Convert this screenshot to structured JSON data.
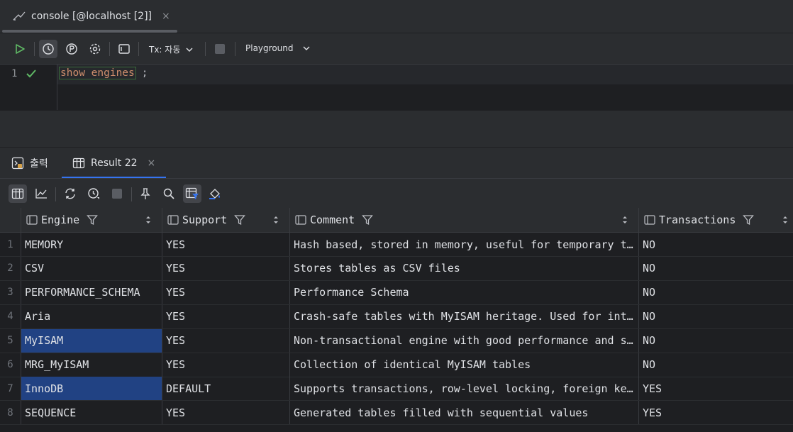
{
  "tab": {
    "title": "console [@localhost [2]]",
    "close": "×"
  },
  "toolbar": {
    "tx_label": "Tx: 자동",
    "playground_label": "Playground"
  },
  "editor": {
    "line_number": "1",
    "code_keyword": "show engines",
    "code_rest": ";"
  },
  "result_tabs": [
    {
      "label": "출력"
    },
    {
      "label": "Result 22",
      "close": "×"
    }
  ],
  "table": {
    "columns": [
      "Engine",
      "Support",
      "Comment",
      "Transactions"
    ],
    "rows": [
      {
        "num": "1",
        "engine": "MEMORY",
        "support": "YES",
        "comment": "Hash based, stored in memory, useful for temporary tables",
        "transactions": "NO"
      },
      {
        "num": "2",
        "engine": "CSV",
        "support": "YES",
        "comment": "Stores tables as CSV files",
        "transactions": "NO"
      },
      {
        "num": "3",
        "engine": "PERFORMANCE_SCHEMA",
        "support": "YES",
        "comment": "Performance Schema",
        "transactions": "NO"
      },
      {
        "num": "4",
        "engine": "Aria",
        "support": "YES",
        "comment": "Crash-safe tables with MyISAM heritage. Used for internal temporary tables",
        "transactions": "NO"
      },
      {
        "num": "5",
        "engine": "MyISAM",
        "support": "YES",
        "comment": "Non-transactional engine with good performance and small data footprint",
        "transactions": "NO"
      },
      {
        "num": "6",
        "engine": "MRG_MyISAM",
        "support": "YES",
        "comment": "Collection of identical MyISAM tables",
        "transactions": "NO"
      },
      {
        "num": "7",
        "engine": "InnoDB",
        "support": "DEFAULT",
        "comment": "Supports transactions, row-level locking, foreign keys and encryption for tables",
        "transactions": "YES"
      },
      {
        "num": "8",
        "engine": "SEQUENCE",
        "support": "YES",
        "comment": "Generated tables filled with sequential values",
        "transactions": "YES"
      }
    ]
  },
  "colors": {
    "accent": "#3574f0",
    "selection": "#214283",
    "run_green": "#5fb865",
    "keyword": "#cf8e6d"
  }
}
